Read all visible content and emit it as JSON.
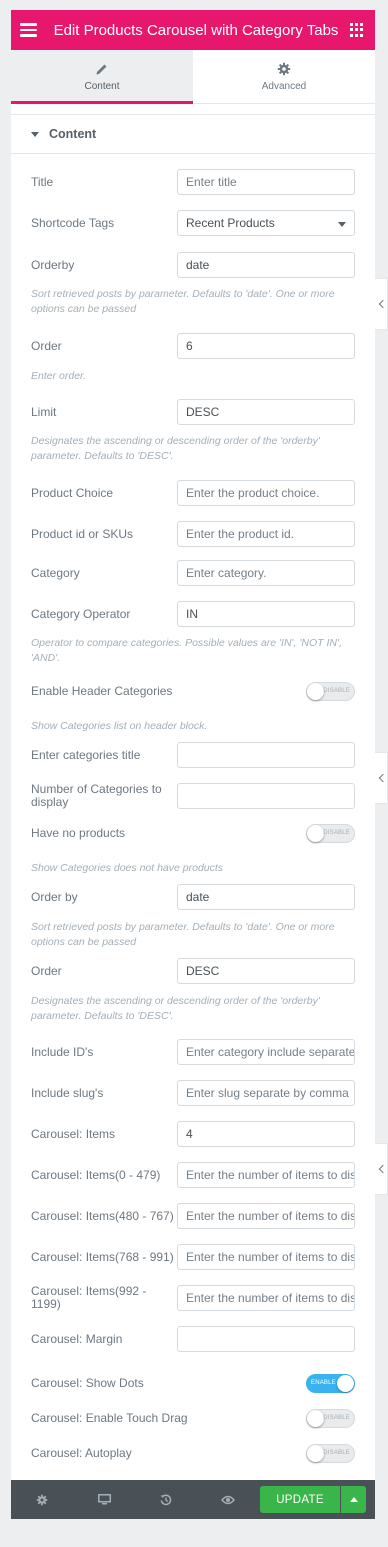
{
  "header": {
    "title": "Edit Products Carousel with Category Tabs",
    "menu_icon": "hamburger-icon",
    "apps_icon": "grid-icon",
    "color": "#e6176d"
  },
  "tabs": [
    {
      "label": "Content",
      "icon": "pencil-icon",
      "active": true
    },
    {
      "label": "Advanced",
      "icon": "gear-icon",
      "active": false
    }
  ],
  "section": {
    "title": "Content"
  },
  "fields": {
    "title": {
      "label": "Title",
      "placeholder": "Enter title"
    },
    "shortcode_tags": {
      "label": "Shortcode Tags",
      "value": "Recent Products"
    },
    "orderby": {
      "label": "Orderby",
      "value": "date",
      "desc": "Sort retrieved posts by parameter. Defaults to 'date'. One or more options can be passed"
    },
    "order": {
      "label": "Order",
      "value": "6",
      "desc": "Enter order."
    },
    "limit": {
      "label": "Limit",
      "value": "DESC",
      "desc": "Designates the ascending or descending order of the 'orderby' parameter. Defaults to 'DESC'."
    },
    "product_choice": {
      "label": "Product Choice",
      "placeholder": "Enter the product choice."
    },
    "product_ids": {
      "label": "Product id or SKUs",
      "placeholder": "Enter the product id."
    },
    "category": {
      "label": "Category",
      "placeholder": "Enter category."
    },
    "category_operator": {
      "label": "Category Operator",
      "value": "IN",
      "desc": "Operator to compare categories. Possible values are 'IN', 'NOT IN', 'AND'."
    },
    "enable_header_categories": {
      "label": "Enable Header Categories",
      "state": "DISABLE",
      "desc": "Show Categories list on header block."
    },
    "categories_title": {
      "label": "Enter categories title",
      "value": ""
    },
    "num_categories": {
      "label": "Number of Categories to display",
      "value": ""
    },
    "have_no_products": {
      "label": "Have no products",
      "state": "DISABLE",
      "desc": "Show Categories does not have products"
    },
    "order_by": {
      "label": "Order by",
      "value": "date",
      "desc": "Sort retrieved posts by parameter. Defaults to 'date'. One or more options can be passed"
    },
    "order2": {
      "label": "Order",
      "value": "DESC",
      "desc": "Designates the ascending or descending order of the 'orderby' parameter. Defaults to 'DESC'."
    },
    "include_ids": {
      "label": "Include ID's",
      "placeholder": "Enter category include separate by comma"
    },
    "include_slugs": {
      "label": "Include slug's",
      "placeholder": "Enter slug separate by comma"
    },
    "carousel_items": {
      "label": "Carousel: Items",
      "value": "4"
    },
    "carousel_items_0_479": {
      "label": "Carousel: Items(0 - 479)",
      "placeholder": "Enter the number of items to display"
    },
    "carousel_items_480_767": {
      "label": "Carousel: Items(480 - 767)",
      "placeholder": "Enter the number of items to display"
    },
    "carousel_items_768_991": {
      "label": "Carousel: Items(768 - 991)",
      "placeholder": "Enter the number of items to display"
    },
    "carousel_items_992_1199": {
      "label": "Carousel: Items(992 - 1199)",
      "placeholder": "Enter the number of items to display"
    },
    "carousel_margin": {
      "label": "Carousel: Margin",
      "value": ""
    },
    "carousel_show_dots": {
      "label": "Carousel: Show Dots",
      "state": "ENABLE"
    },
    "carousel_touch_drag": {
      "label": "Carousel: Enable Touch Drag",
      "state": "DISABLE"
    },
    "carousel_autoplay": {
      "label": "Carousel: Autoplay",
      "state": "DISABLE"
    }
  },
  "footer": {
    "update_label": "UPDATE",
    "icons": [
      "settings-icon",
      "responsive-icon",
      "history-icon",
      "preview-icon"
    ],
    "update_color": "#39b54a"
  }
}
